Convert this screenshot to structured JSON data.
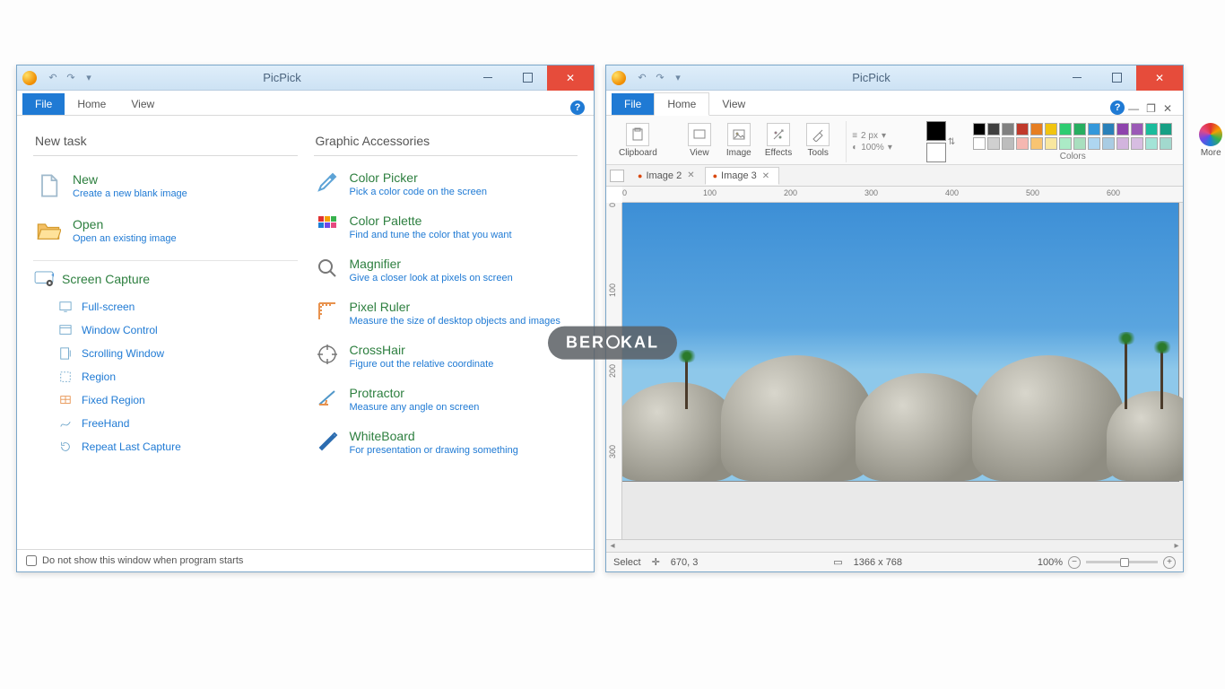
{
  "watermark": {
    "pre": "BER",
    "post": "KAL"
  },
  "windowA": {
    "title": "PicPick",
    "tabs": {
      "file": "File",
      "home": "Home",
      "view": "View"
    },
    "sections": {
      "newTask": "New task",
      "graphicAccessories": "Graphic Accessories"
    },
    "newTask": {
      "new": {
        "title": "New",
        "desc": "Create a new blank image"
      },
      "open": {
        "title": "Open",
        "desc": "Open an existing image"
      }
    },
    "screenCapture": {
      "title": "Screen Capture",
      "items": {
        "fullscreen": "Full-screen",
        "windowControl": "Window Control",
        "scrolling": "Scrolling Window",
        "region": "Region",
        "fixedRegion": "Fixed Region",
        "freehand": "FreeHand",
        "repeat": "Repeat Last Capture"
      }
    },
    "accessories": {
      "colorPicker": {
        "title": "Color Picker",
        "desc": "Pick a color code on the screen"
      },
      "colorPalette": {
        "title": "Color Palette",
        "desc": "Find and tune the color that you want"
      },
      "magnifier": {
        "title": "Magnifier",
        "desc": "Give a closer look at pixels on screen"
      },
      "pixelRuler": {
        "title": "Pixel Ruler",
        "desc": "Measure the size of desktop objects and images"
      },
      "crosshair": {
        "title": "CrossHair",
        "desc": "Figure out the relative coordinate"
      },
      "protractor": {
        "title": "Protractor",
        "desc": "Measure any angle on screen"
      },
      "whiteboard": {
        "title": "WhiteBoard",
        "desc": "For presentation or drawing something"
      }
    },
    "footer": {
      "dontShow": "Do not show this window when program starts"
    }
  },
  "windowB": {
    "title": "PicPick",
    "tabs": {
      "file": "File",
      "home": "Home",
      "view": "View"
    },
    "ribbon": {
      "clipboard": "Clipboard",
      "view": "View",
      "image": "Image",
      "effects": "Effects",
      "tools": "Tools",
      "strokeSize": "2 px",
      "strokeOpacity": "100%",
      "colorsLabel": "Colors",
      "more": "More"
    },
    "palette": [
      "#000000",
      "#404040",
      "#808080",
      "#c0392b",
      "#e67e22",
      "#f1c40f",
      "#2ecc71",
      "#27ae60",
      "#3498db",
      "#2980b9",
      "#8e44ad",
      "#9b59b6",
      "#1abc9c",
      "#16a085",
      "#ffffff",
      "#d0d0d0",
      "#bdbdbd",
      "#f5b7b1",
      "#f8c471",
      "#f9e79f",
      "#abebc6",
      "#a9dfbf",
      "#aed6f1",
      "#a9cce3",
      "#d2b4de",
      "#d7bde2",
      "#a3e4d7",
      "#a2d9ce"
    ],
    "foreground": "#000000",
    "background": "#ffffff",
    "docTabs": {
      "tab1": "Image 2",
      "tab2": "Image 3"
    },
    "rulerH": [
      "0",
      "100",
      "200",
      "300",
      "400",
      "500",
      "600"
    ],
    "rulerV": [
      "0",
      "100",
      "200",
      "300"
    ],
    "status": {
      "mode": "Select",
      "coords": "670, 3",
      "dimensions": "1366 x 768",
      "zoom": "100%"
    }
  }
}
